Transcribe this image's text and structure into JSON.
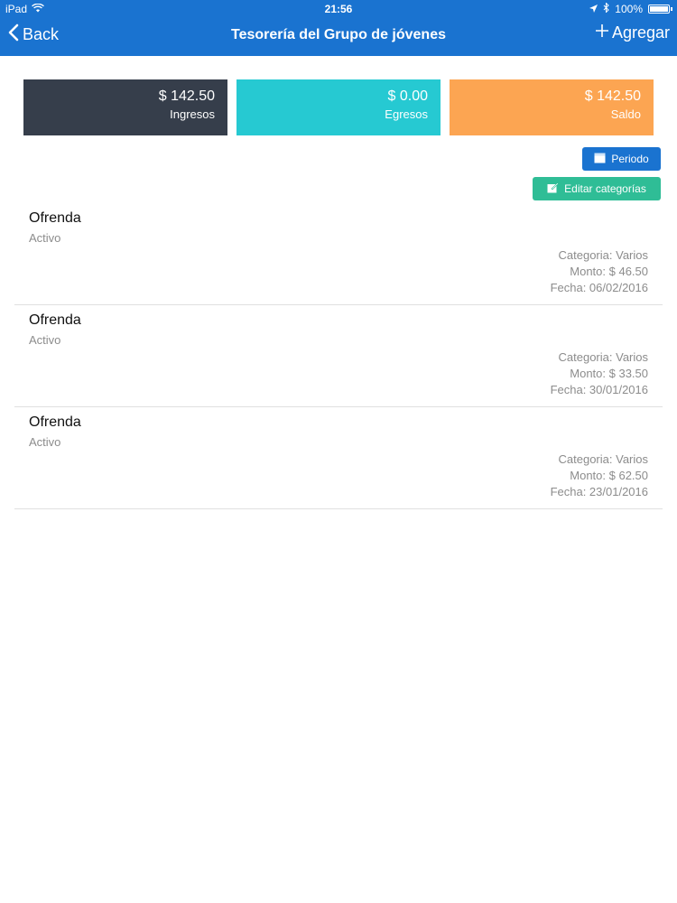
{
  "status_bar": {
    "device": "iPad",
    "time": "21:56",
    "battery": "100%",
    "battery_level": 1.0
  },
  "nav": {
    "back_label": "Back",
    "title": "Tesorería del Grupo de jóvenes",
    "add_label": "Agregar"
  },
  "summary": {
    "ingresos": {
      "amount": "$ 142.50",
      "label": "Ingresos",
      "color": "#363e4b"
    },
    "egresos": {
      "amount": "$ 0.00",
      "label": "Egresos",
      "color": "#26c9d2"
    },
    "saldo": {
      "amount": "$ 142.50",
      "label": "Saldo",
      "color": "#fca552"
    }
  },
  "actions": {
    "periodo_label": "Periodo",
    "categorias_label": "Editar categorías"
  },
  "items": [
    {
      "title": "Ofrenda",
      "status": "Activo",
      "categoria": "Categoria: Varios",
      "monto": "Monto: $ 46.50",
      "fecha": "Fecha: 06/02/2016"
    },
    {
      "title": "Ofrenda",
      "status": "Activo",
      "categoria": "Categoria: Varios",
      "monto": "Monto: $ 33.50",
      "fecha": "Fecha: 30/01/2016"
    },
    {
      "title": "Ofrenda",
      "status": "Activo",
      "categoria": "Categoria: Varios",
      "monto": "Monto: $ 62.50",
      "fecha": "Fecha: 23/01/2016"
    }
  ],
  "colors": {
    "accent": "#1a73d0",
    "success": "#2fbd96"
  }
}
